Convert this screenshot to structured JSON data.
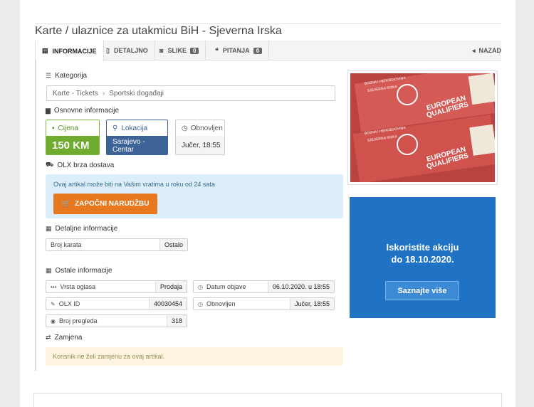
{
  "title": "Karte / ulaznice za utakmicu BiH - Sjeverna Irska",
  "tabs": [
    {
      "label": "INFORMACIJE",
      "icon": "info-card-icon"
    },
    {
      "label": "DETALJNO",
      "icon": "document-icon"
    },
    {
      "label": "SLIKE",
      "icon": "camera-icon",
      "count": "0"
    },
    {
      "label": "PITANJA",
      "icon": "chat-icon",
      "count": "0"
    }
  ],
  "back_label": "NAZAD",
  "kategorija": {
    "heading": "Kategorija",
    "breadcrumb": [
      "Karte - Tickets",
      "Sportski događaji"
    ]
  },
  "osnovne": {
    "heading": "Osnovne informacije",
    "price": {
      "label": "Cijena",
      "value": "150 KM"
    },
    "location": {
      "label": "Lokacija",
      "value": "Sarajevo - Centar"
    },
    "updated": {
      "label": "Obnovljen",
      "value": "Jučer, 18:55"
    }
  },
  "delivery": {
    "heading": "OLX brza dostava",
    "text": "Ovaj artikal može biti na Vašim vratima u roku od 24 sata",
    "button": "ZAPOČNI NARUDŽBU"
  },
  "detaljne": {
    "heading": "Detaljne informacije",
    "rows": [
      {
        "key": "Broj karata",
        "value": "Ostalo"
      }
    ]
  },
  "ostale": {
    "heading": "Ostale informacije",
    "vrsta": {
      "key": "Vrsta oglasa",
      "value": "Prodaja"
    },
    "datum": {
      "key": "Datum objave",
      "value": "06.10.2020. u 18:55"
    },
    "olxid": {
      "key": "OLX ID",
      "value": "40030454"
    },
    "obnovljen": {
      "key": "Obnovljen",
      "value": "Jučer, 18:55"
    },
    "pregleda": {
      "key": "Broj pregleda",
      "value": "318"
    }
  },
  "zamjena": {
    "heading": "Zamjena",
    "text": "Korisnik ne želi zamjenu za ovaj artikal."
  },
  "ticket_image": {
    "top_text": "BOSNA I HERCEGOVINA",
    "top_text2": "SJEVERNA IRSKA",
    "brand": "EUROPEAN",
    "brand2": "QUALIFIERS"
  },
  "ad": {
    "line1": "Iskoristite akciju",
    "line2": "do 18.10.2020.",
    "button": "Saznajte više"
  },
  "colors": {
    "price_green": "#6eab2e",
    "location_blue": "#3d6396",
    "order_orange": "#e8781e",
    "ad_blue": "#1f72c4"
  }
}
